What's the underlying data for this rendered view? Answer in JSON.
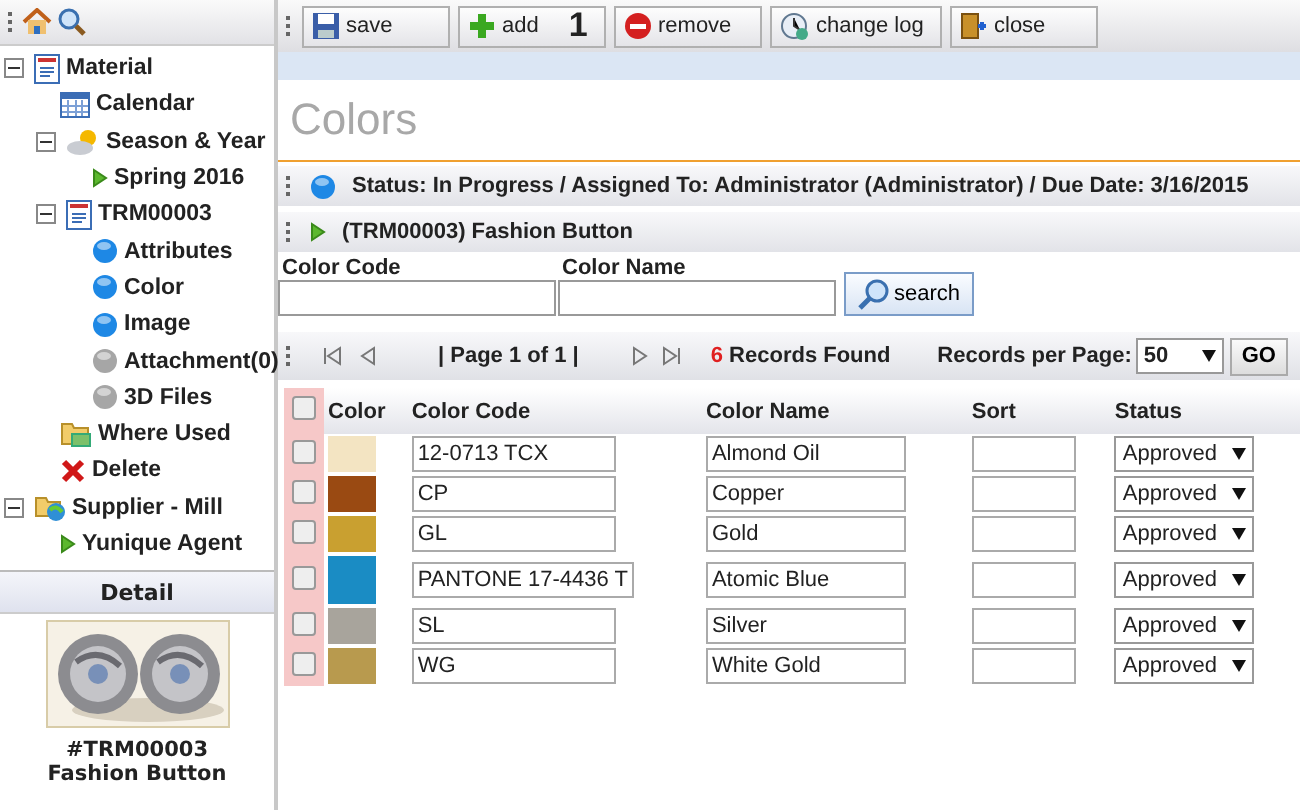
{
  "sidebar": {
    "tree": [
      {
        "label": "Material",
        "kind": "document",
        "expanded": true,
        "children": [
          {
            "label": "Calendar",
            "kind": "calendar"
          },
          {
            "label": "Season & Year",
            "kind": "weather",
            "expanded": true,
            "children": [
              {
                "label": "Spring 2016",
                "kind": "arrow"
              }
            ]
          },
          {
            "label": "TRM00003",
            "kind": "document",
            "expanded": true,
            "children": [
              {
                "label": "Attributes",
                "kind": "dot",
                "color": "#1e88e5"
              },
              {
                "label": "Color",
                "kind": "dot",
                "color": "#1e88e5"
              },
              {
                "label": "Image",
                "kind": "dot",
                "color": "#1e88e5"
              },
              {
                "label": "Attachment(0)",
                "kind": "dot",
                "color": "#a6a6a6"
              },
              {
                "label": "3D Files",
                "kind": "dot",
                "color": "#a6a6a6"
              }
            ]
          },
          {
            "label": "Where Used",
            "kind": "folder"
          },
          {
            "label": "Delete",
            "kind": "delete"
          }
        ]
      },
      {
        "label": "Supplier - Mill",
        "kind": "globe",
        "expanded": true,
        "children": [
          {
            "label": "Yunique Agent",
            "kind": "arrow"
          }
        ]
      }
    ],
    "detail": {
      "title": "Detail",
      "caption_lines": [
        "#TRM00003",
        "Fashion Button"
      ]
    }
  },
  "toolbar": [
    {
      "label": "save",
      "kind": "save"
    },
    {
      "label": "add",
      "kind": "add",
      "count": "1"
    },
    {
      "label": "remove",
      "kind": "remove"
    },
    {
      "label": "change log",
      "kind": "log"
    },
    {
      "label": "close",
      "kind": "close"
    }
  ],
  "page_title": "Colors",
  "status_line": "Status: In Progress / Assigned To: Administrator (Administrator) / Due Date: 3/16/2015",
  "item_line": "(TRM00003) Fashion Button",
  "search": {
    "fields": [
      {
        "label": "Color Code"
      },
      {
        "label": "Color Name"
      }
    ],
    "button": "search"
  },
  "pager": {
    "page_text": "| Page 1 of 1 |",
    "count": "6",
    "found_text": "Records Found",
    "per_page_label": "Records per Page:",
    "per_page": "50",
    "go": "GO"
  },
  "table": {
    "columns": [
      "Color",
      "Color Code",
      "Color Name",
      "Sort",
      "Status"
    ],
    "all_checked": false,
    "rows": [
      {
        "checked": false,
        "color": "#f3e4c2",
        "code": "12-0713 TCX",
        "name": "Almond Oil",
        "status": "Approved"
      },
      {
        "checked": false,
        "color": "#9a4a12",
        "code": "CP",
        "name": "Copper",
        "status": "Approved"
      },
      {
        "checked": false,
        "color": "#c9a030",
        "code": "GL",
        "name": "Gold",
        "status": "Approved"
      },
      {
        "checked": false,
        "color": "#1a8cc4",
        "code": "PANTONE 17-4436 T",
        "name": "Atomic Blue",
        "status": "Approved"
      },
      {
        "checked": false,
        "color": "#a8a49c",
        "code": "SL",
        "name": "Silver",
        "status": "Approved"
      },
      {
        "checked": false,
        "color": "#b89a4e",
        "code": "WG",
        "name": "White Gold",
        "status": "Approved"
      }
    ]
  }
}
